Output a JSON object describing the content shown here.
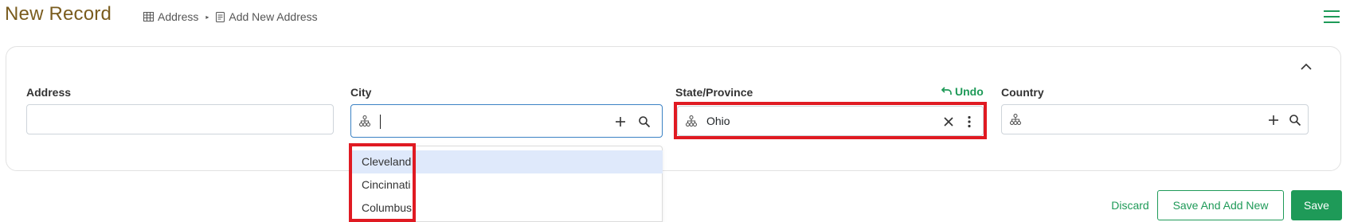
{
  "header": {
    "title": "New Record",
    "breadcrumb": [
      {
        "label": "Address",
        "icon": "table-icon"
      },
      {
        "label": "Add New Address",
        "icon": "document-icon"
      }
    ],
    "menu_icon": "hamburger-menu-icon"
  },
  "form": {
    "address": {
      "label": "Address",
      "value": ""
    },
    "city": {
      "label": "City",
      "value": "",
      "options": [
        "Cleveland",
        "Cincinnati",
        "Columbus"
      ],
      "active_option": "Cleveland"
    },
    "state": {
      "label": "State/Province",
      "value": "Ohio",
      "undo_label": "Undo"
    },
    "country": {
      "label": "Country",
      "value": ""
    }
  },
  "actions": {
    "discard": "Discard",
    "save_and_add_new": "Save And Add New",
    "save": "Save"
  },
  "colors": {
    "title": "#7a5c1e",
    "accent_green": "#1e9a58",
    "highlight_red": "#e01a22",
    "focus_blue": "#3b82c4",
    "dropdown_active": "#dfe9fb"
  }
}
